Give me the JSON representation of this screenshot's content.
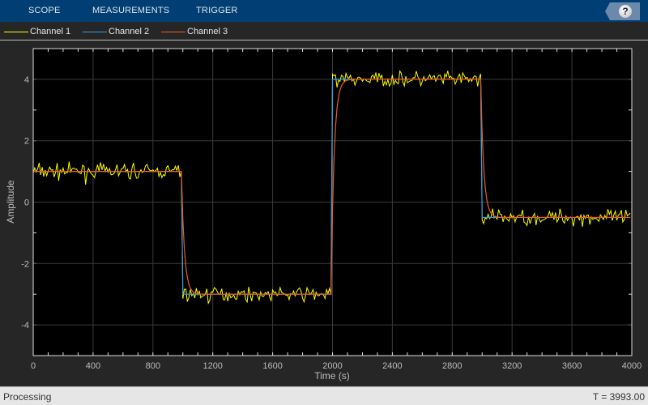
{
  "toolstrip": {
    "tabs": [
      "SCOPE",
      "MEASUREMENTS",
      "TRIGGER"
    ],
    "help_label": "?"
  },
  "legend": [
    {
      "label": "Channel 1",
      "color": "#ffff00"
    },
    {
      "label": "Channel 2",
      "color": "#2f9fe8"
    },
    {
      "label": "Channel 3",
      "color": "#f05a28"
    }
  ],
  "status": {
    "left": "Processing",
    "right": "T = 3993.00"
  },
  "chart_data": {
    "type": "line",
    "xlabel": "Time (s)",
    "ylabel": "Amplitude",
    "xlim": [
      0,
      4000
    ],
    "ylim": [
      -5,
      5
    ],
    "xticks": [
      0,
      400,
      800,
      1200,
      1600,
      2000,
      2400,
      2800,
      3200,
      3600,
      4000
    ],
    "yticks": [
      -4,
      -2,
      0,
      2,
      4
    ],
    "grid": true,
    "levels": [
      {
        "from": 0,
        "to": 1000,
        "value": 1
      },
      {
        "from": 1000,
        "to": 2000,
        "value": -3
      },
      {
        "from": 2000,
        "to": 3000,
        "value": 4
      },
      {
        "from": 3000,
        "to": 4000,
        "value": -0.5
      }
    ],
    "series": [
      {
        "name": "Channel 1",
        "description_kind": "square wave + noise",
        "noise_std": 0.13
      },
      {
        "name": "Channel 2",
        "description_kind": "square wave"
      },
      {
        "name": "Channel 3",
        "description_kind": "first-order filtered",
        "time_constant": 20
      }
    ]
  }
}
